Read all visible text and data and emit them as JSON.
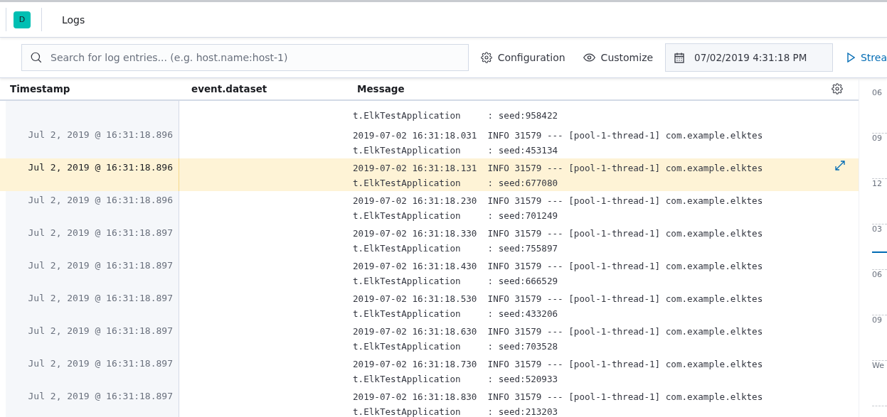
{
  "header": {
    "avatar": "D",
    "title": "Logs"
  },
  "toolbar": {
    "search": {
      "placeholder": "Search for log entries... (e.g. host.name:host-1)"
    },
    "configuration": "Configuration",
    "customize": "Customize",
    "date": "07/02/2019 4:31:18 PM",
    "stream": "Strea"
  },
  "table": {
    "columns": [
      "Timestamp",
      "event.dataset",
      "Message"
    ],
    "rows": [
      {
        "message": [
          "t.ElkTestApplication     : seed:958422"
        ],
        "selected": false
      },
      {
        "timestamp": "Jul 2, 2019 @ 16:31:18.896",
        "message": [
          "2019-07-02 16:31:18.031  INFO 31579 --- [pool-1-thread-1] com.example.elktes",
          "t.ElkTestApplication     : seed:453134"
        ],
        "selected": false
      },
      {
        "timestamp": "Jul 2, 2019 @ 16:31:18.896",
        "message": [
          "2019-07-02 16:31:18.131  INFO 31579 --- [pool-1-thread-1] com.example.elktes",
          "t.ElkTestApplication     : seed:677080"
        ],
        "selected": true
      },
      {
        "timestamp": "Jul 2, 2019 @ 16:31:18.896",
        "message": [
          "2019-07-02 16:31:18.230  INFO 31579 --- [pool-1-thread-1] com.example.elktes",
          "t.ElkTestApplication     : seed:701249"
        ],
        "selected": false
      },
      {
        "timestamp": "Jul 2, 2019 @ 16:31:18.897",
        "message": [
          "2019-07-02 16:31:18.330  INFO 31579 --- [pool-1-thread-1] com.example.elktes",
          "t.ElkTestApplication     : seed:755897"
        ],
        "selected": false
      },
      {
        "timestamp": "Jul 2, 2019 @ 16:31:18.897",
        "message": [
          "2019-07-02 16:31:18.430  INFO 31579 --- [pool-1-thread-1] com.example.elktes",
          "t.ElkTestApplication     : seed:666529"
        ],
        "selected": false
      },
      {
        "timestamp": "Jul 2, 2019 @ 16:31:18.897",
        "message": [
          "2019-07-02 16:31:18.530  INFO 31579 --- [pool-1-thread-1] com.example.elktes",
          "t.ElkTestApplication     : seed:433206"
        ],
        "selected": false
      },
      {
        "timestamp": "Jul 2, 2019 @ 16:31:18.897",
        "message": [
          "2019-07-02 16:31:18.630  INFO 31579 --- [pool-1-thread-1] com.example.elktes",
          "t.ElkTestApplication     : seed:703528"
        ],
        "selected": false
      },
      {
        "timestamp": "Jul 2, 2019 @ 16:31:18.897",
        "message": [
          "2019-07-02 16:31:18.730  INFO 31579 --- [pool-1-thread-1] com.example.elktes",
          "t.ElkTestApplication     : seed:520933"
        ],
        "selected": false
      },
      {
        "timestamp": "Jul 2, 2019 @ 16:31:18.897",
        "message": [
          "2019-07-02 16:31:18.830  INFO 31579 --- [pool-1-thread-1] com.example.elktes",
          "t.ElkTestApplication     : seed:213203"
        ],
        "selected": false
      }
    ]
  },
  "timeline": [
    {
      "label": "06"
    },
    {
      "label": "09"
    },
    {
      "label": "12"
    },
    {
      "label": "03"
    },
    {
      "label": "06"
    },
    {
      "label": "09"
    },
    {
      "label": "We"
    }
  ]
}
